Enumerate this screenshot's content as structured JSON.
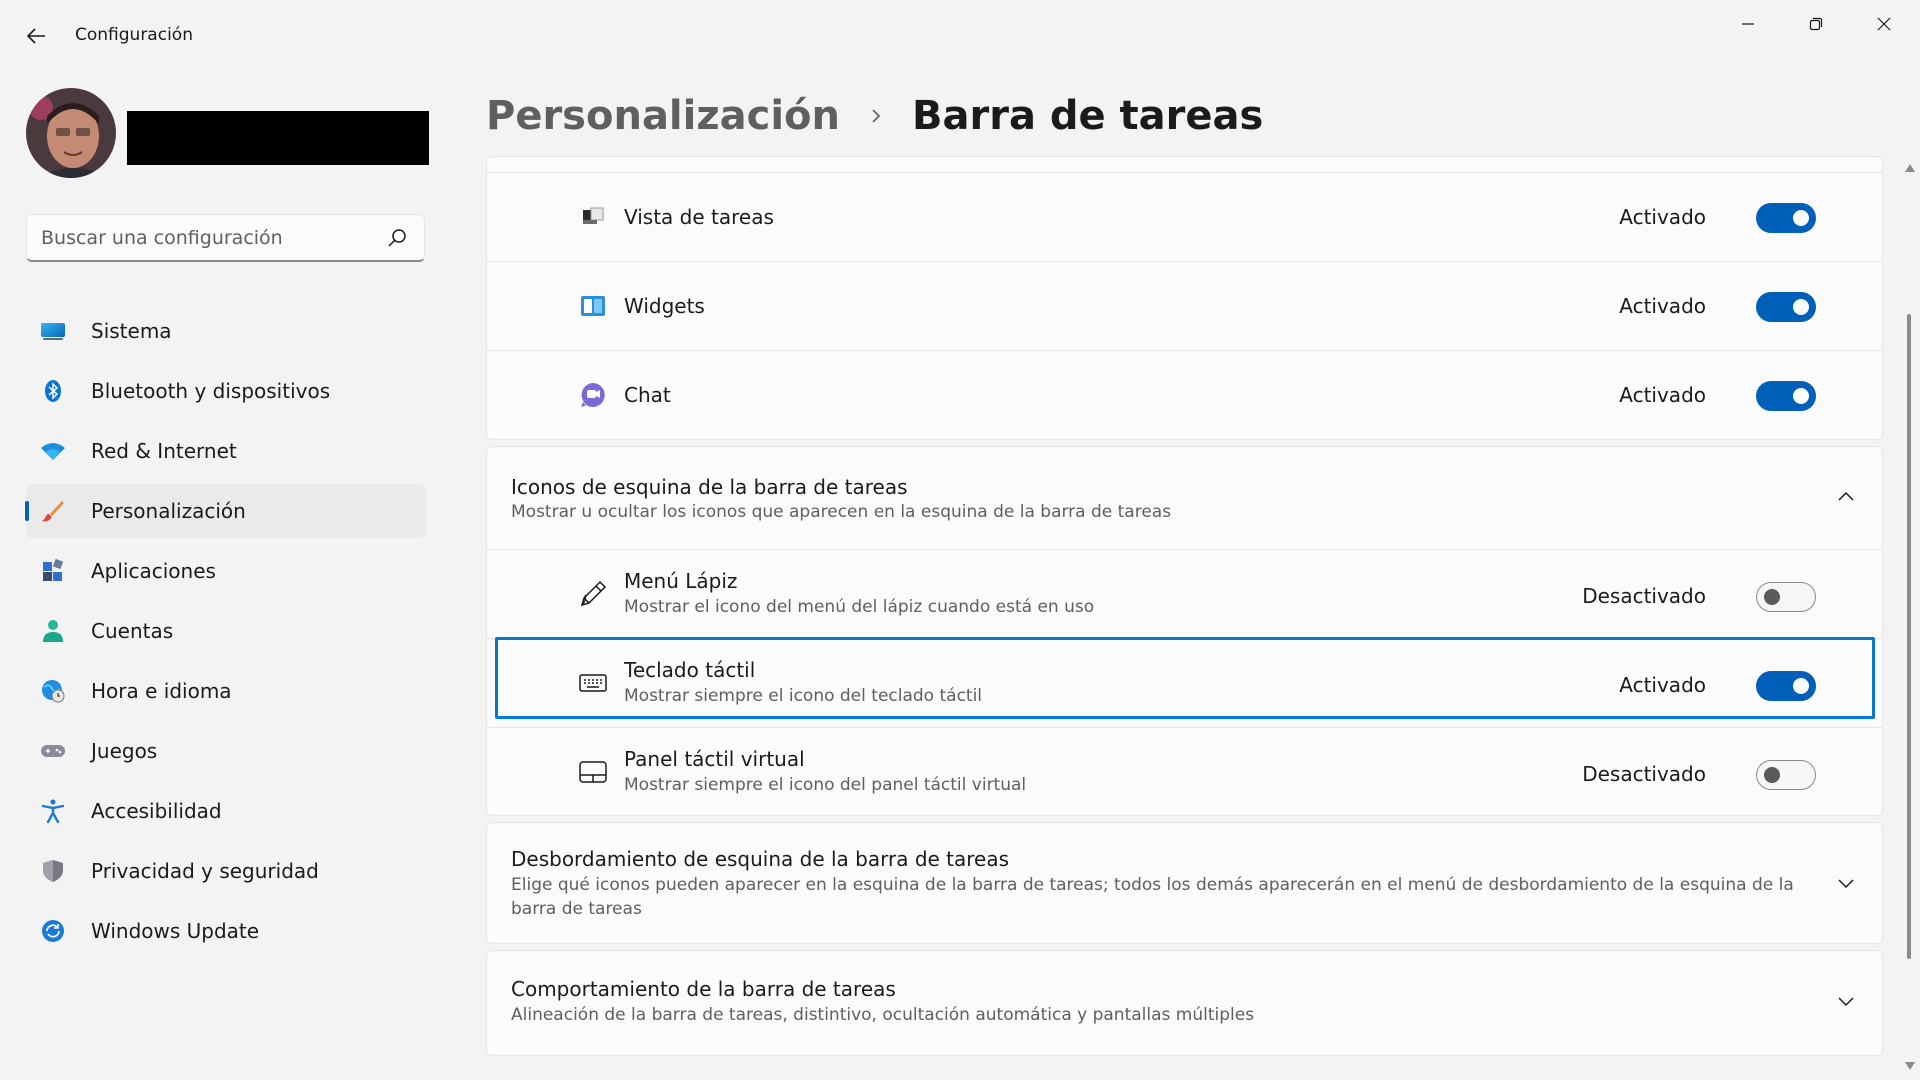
{
  "window": {
    "title": "Configuración",
    "controls": [
      "minimize-icon",
      "maximize-icon",
      "close-icon"
    ]
  },
  "search": {
    "placeholder": "Buscar una configuración"
  },
  "sidebar": {
    "selected": "Personalización",
    "items": [
      {
        "label": "Sistema",
        "icon": "monitor-icon"
      },
      {
        "label": "Bluetooth y dispositivos",
        "icon": "bluetooth-icon"
      },
      {
        "label": "Red & Internet",
        "icon": "wifi-icon"
      },
      {
        "label": "Personalización",
        "icon": "brush-icon"
      },
      {
        "label": "Aplicaciones",
        "icon": "apps-icon"
      },
      {
        "label": "Cuentas",
        "icon": "person-icon"
      },
      {
        "label": "Hora e idioma",
        "icon": "globe-clock-icon"
      },
      {
        "label": "Juegos",
        "icon": "gamepad-icon"
      },
      {
        "label": "Accesibilidad",
        "icon": "accessibility-icon"
      },
      {
        "label": "Privacidad y seguridad",
        "icon": "shield-icon"
      },
      {
        "label": "Windows Update",
        "icon": "update-icon"
      }
    ]
  },
  "breadcrumb": {
    "parent": "Personalización",
    "current": "Barra de tareas"
  },
  "taskbar_items": [
    {
      "title": "Vista de tareas",
      "state": "Activado",
      "on": true,
      "icon": "task-view-icon"
    },
    {
      "title": "Widgets",
      "state": "Activado",
      "on": true,
      "icon": "widgets-icon"
    },
    {
      "title": "Chat",
      "state": "Activado",
      "on": true,
      "icon": "chat-icon"
    }
  ],
  "corner_icons": {
    "title": "Iconos de esquina de la barra de tareas",
    "description": "Mostrar u ocultar los iconos que aparecen en la esquina de la barra de tareas",
    "expanded": true,
    "items": [
      {
        "title": "Menú Lápiz",
        "description": "Mostrar el icono del menú del lápiz cuando está en uso",
        "state": "Desactivado",
        "on": false,
        "icon": "pen-icon"
      },
      {
        "title": "Teclado táctil",
        "description": "Mostrar siempre el icono del teclado táctil",
        "state": "Activado",
        "on": true,
        "icon": "keyboard-icon",
        "focused": true
      },
      {
        "title": "Panel táctil virtual",
        "description": "Mostrar siempre el icono del panel táctil virtual",
        "state": "Desactivado",
        "on": false,
        "icon": "touchpad-icon"
      }
    ]
  },
  "overflow": {
    "title": "Desbordamiento de esquina de la barra de tareas",
    "description": "Elige qué iconos pueden aparecer en la esquina de la barra de tareas; todos los demás aparecerán en el menú de desbordamiento de la esquina de la barra de tareas",
    "expanded": false
  },
  "behavior": {
    "title": "Comportamiento de la barra de tareas",
    "description": "Alineación de la barra de tareas, distintivo, ocultación automática y pantallas múltiples",
    "expanded": false
  },
  "colors": {
    "accent": "#005fb8",
    "focus": "#0078d4",
    "background": "#f3f3f3",
    "card": "#fbfbfb"
  }
}
